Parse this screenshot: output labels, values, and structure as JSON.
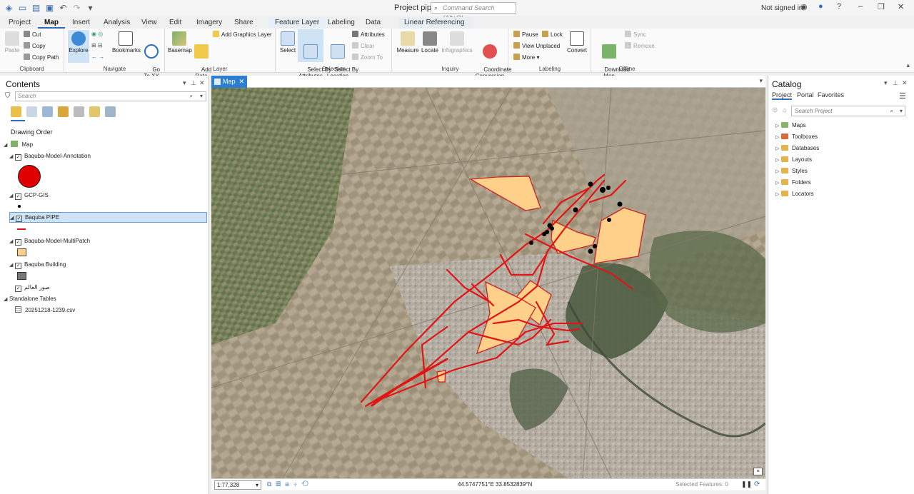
{
  "window": {
    "project_title": "Project pipe",
    "command_search_placeholder": "Command Search (Alt+Q)",
    "signin": "Not signed in"
  },
  "tabs": [
    "Project",
    "Map",
    "Insert",
    "Analysis",
    "View",
    "Edit",
    "Imagery",
    "Share",
    "Feature Layer",
    "Labeling",
    "Data",
    "Linear Referencing"
  ],
  "ribbon": {
    "clipboard": {
      "label": "Clipboard",
      "paste": "Paste",
      "cut": "Cut",
      "copy": "Copy",
      "copy_path": "Copy Path"
    },
    "navigate": {
      "label": "Navigate",
      "explore": "Explore",
      "bookmarks": "Bookmarks",
      "goto": "Go\nTo XY"
    },
    "layer": {
      "label": "Layer",
      "basemap": "Basemap",
      "add_data": "Add\nData",
      "add_graphics": "Add Graphics Layer"
    },
    "selection": {
      "label": "Selection",
      "select": "Select",
      "select_attr": "Select By\nAttributes",
      "select_loc": "Select By\nLocation",
      "attributes": "Attributes",
      "clear": "Clear",
      "zoom_to": "Zoom To"
    },
    "inquiry": {
      "label": "Inquiry",
      "measure": "Measure",
      "locate": "Locate",
      "infographics": "Infographics",
      "coord_conv": "Coordinate\nConversion"
    },
    "labeling": {
      "label": "Labeling",
      "pause": "Pause",
      "lock": "Lock",
      "view_unplaced": "View Unplaced",
      "more": "More",
      "convert": "Convert"
    },
    "offline": {
      "label": "Offline",
      "download": "Download\nMap",
      "sync": "Sync",
      "remove": "Remove"
    }
  },
  "contents": {
    "title": "Contents",
    "search_placeholder": "Search",
    "drawing_order": "Drawing Order",
    "map_name": "Map",
    "layers": [
      "Baquba-Model-Annotation",
      "GCP-GIS",
      "Baquba PIPE",
      "Baquba-Model-MultiPatch",
      "Baquba Building",
      "صور العالم"
    ],
    "standalone_tables": "Standalone Tables",
    "table_file": "20251218-1239.csv"
  },
  "map": {
    "tab_label": "Map",
    "scale": "1:77,328",
    "coordinates": "44.5747751°E 33.8532839°N",
    "selected_features": "Selected Features: 0"
  },
  "catalog": {
    "title": "Catalog",
    "tabs": [
      "Project",
      "Portal",
      "Favorites"
    ],
    "search_placeholder": "Search Project",
    "items": [
      "Maps",
      "Toolboxes",
      "Databases",
      "Layouts",
      "Styles",
      "Folders",
      "Locators"
    ]
  },
  "colors": {
    "accent": "#2c6fbd",
    "pipe": "#e01616",
    "building_fill": "#ffd08a",
    "annotation": "#e00000"
  }
}
